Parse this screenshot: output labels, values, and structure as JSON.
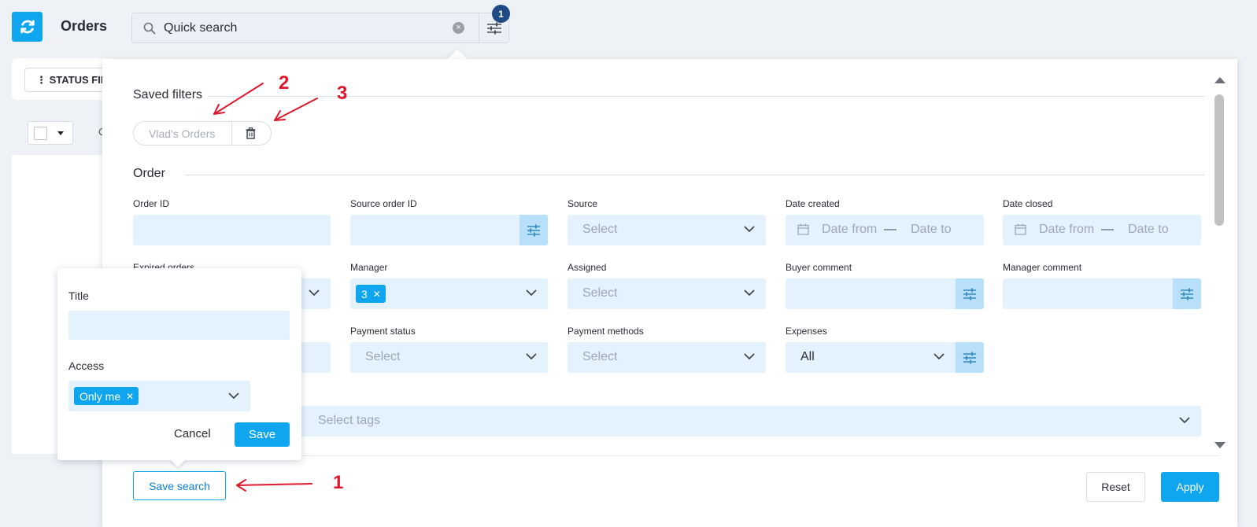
{
  "header": {
    "title": "Orders",
    "search_text": "Quick search",
    "filter_badge": "1"
  },
  "toolbar": {
    "status_filter_label": "⋮ STATUS FIL",
    "partial_col": "C"
  },
  "saved_filters": {
    "title": "Saved filters",
    "items": [
      {
        "label": "Vlad's Orders"
      }
    ]
  },
  "order_section": {
    "title": "Order",
    "fields": {
      "order_id": {
        "label": "Order ID"
      },
      "source_order_id": {
        "label": "Source order ID"
      },
      "source": {
        "label": "Source",
        "placeholder": "Select"
      },
      "date_created": {
        "label": "Date created",
        "from": "Date from",
        "dash": "—",
        "to": "Date to"
      },
      "date_closed": {
        "label": "Date closed",
        "from": "Date from",
        "dash": "—",
        "to": "Date to"
      },
      "expired_orders": {
        "label": "Expired orders"
      },
      "manager": {
        "label": "Manager",
        "tag": "3"
      },
      "assigned": {
        "label": "Assigned",
        "placeholder": "Select"
      },
      "buyer_comment": {
        "label": "Buyer comment"
      },
      "manager_comment": {
        "label": "Manager comment"
      },
      "payment_status": {
        "label": "Payment status",
        "placeholder": "Select"
      },
      "payment_methods": {
        "label": "Payment methods",
        "placeholder": "Select"
      },
      "expenses": {
        "label": "Expenses",
        "value": "All"
      },
      "tags": {
        "placeholder": "Select tags"
      }
    }
  },
  "footer": {
    "save_search": "Save search",
    "reset": "Reset",
    "apply": "Apply"
  },
  "save_popup": {
    "title_label": "Title",
    "access_label": "Access",
    "access_tag": "Only me",
    "cancel": "Cancel",
    "save": "Save"
  },
  "annotations": [
    "1",
    "2",
    "3"
  ],
  "colors": {
    "accent": "#10a6ef",
    "field_bg": "#e3f2fd",
    "annotation": "#e0182d",
    "badge": "#1f4a85"
  }
}
